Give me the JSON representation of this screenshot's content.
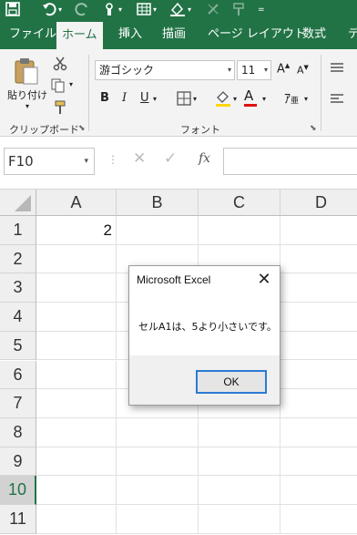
{
  "ribbon": {
    "tabs": [
      "ファイル",
      "ホーム",
      "挿入",
      "描画",
      "ページ レイアウト",
      "数式",
      "デ"
    ],
    "active_tab": "ホーム",
    "clipboard": {
      "paste_label": "貼り付け",
      "group_label": "クリップボード"
    },
    "font": {
      "font_name": "游ゴシック",
      "font_size": "11",
      "bold": "B",
      "italic": "I",
      "underline": "U",
      "group_label": "フォント"
    }
  },
  "formula_bar": {
    "name_box": "F10",
    "fx_label": "fx",
    "formula_value": ""
  },
  "grid": {
    "columns": [
      "A",
      "B",
      "C",
      "D"
    ],
    "rows": [
      "1",
      "2",
      "3",
      "4",
      "5",
      "6",
      "7",
      "8",
      "9",
      "10",
      "11"
    ],
    "selected_row": "10",
    "cells": {
      "A1": "2"
    }
  },
  "dialog": {
    "title": "Microsoft Excel",
    "message": "セルA1は、5より小さいです。",
    "ok_label": "OK"
  },
  "colors": {
    "excel_green": "#217346",
    "ribbon_bg": "#f3f3f3",
    "focus_blue": "#2a7bd2",
    "font_color_red": "#e01010"
  }
}
